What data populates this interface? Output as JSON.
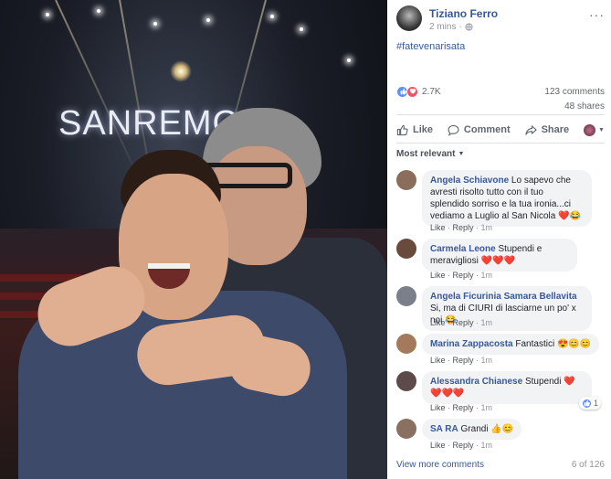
{
  "photo": {
    "sign_text": "SANREMO"
  },
  "post": {
    "author": "Tiziano Ferro",
    "time": "2 mins",
    "privacy_icon": "globe-icon",
    "more_icon": "ellipsis-icon",
    "more_label": "···",
    "text": "#fatevenarisata",
    "reaction_count": "2.7K",
    "comments_count": "123 comments",
    "shares_count": "48 shares"
  },
  "actions": {
    "like": "Like",
    "comment": "Comment",
    "share": "Share"
  },
  "sort": {
    "label": "Most relevant"
  },
  "comments": [
    {
      "name": "Angela Schiavone",
      "text": "Lo sapevo che avresti risolto tutto con il tuo splendido sorriso e la tua ironia...ci vediamo a Luglio al San Nicola",
      "emoji": "❤️😂",
      "like": "Like",
      "reply": "Reply",
      "time": "1m",
      "avatar_color": "#8a6d5a"
    },
    {
      "name": "Carmela Leone",
      "text": "Stupendi e meravigliosi",
      "emoji": "❤️❤️❤️",
      "like": "Like",
      "reply": "Reply",
      "time": "1m",
      "avatar_color": "#6b4a3e"
    },
    {
      "name": "Angela Ficurinia Samara Bellavita",
      "text": "Si, ma di CIURI di lasciarne un po' x noi",
      "emoji": "😂",
      "like": "Like",
      "reply": "Reply",
      "time": "1m",
      "avatar_color": "#7a7f8a"
    },
    {
      "name": "Marina Zappacosta",
      "text": "Fantastici",
      "emoji": "😍😊😊",
      "like": "Like",
      "reply": "Reply",
      "time": "1m",
      "avatar_color": "#a57a5c"
    },
    {
      "name": "Alessandra Chianese",
      "text": "Stupendi",
      "emoji": "❤️❤️❤️❤️",
      "like": "Like",
      "reply": "Reply",
      "time": "1m",
      "avatar_color": "#5d4a4a",
      "likes": "1"
    },
    {
      "name": "SA RA",
      "text": "Grandi",
      "emoji": "👍😊",
      "like": "Like",
      "reply": "Reply",
      "time": "1m",
      "avatar_color": "#8a7060"
    }
  ],
  "footer": {
    "view_more": "View more comments",
    "pagination": "6 of 126"
  },
  "colors": {
    "link": "#385898",
    "muted": "#90949c",
    "bubble": "#f2f3f5",
    "like_blue": "#5890ff",
    "love_red": "#f25268"
  }
}
